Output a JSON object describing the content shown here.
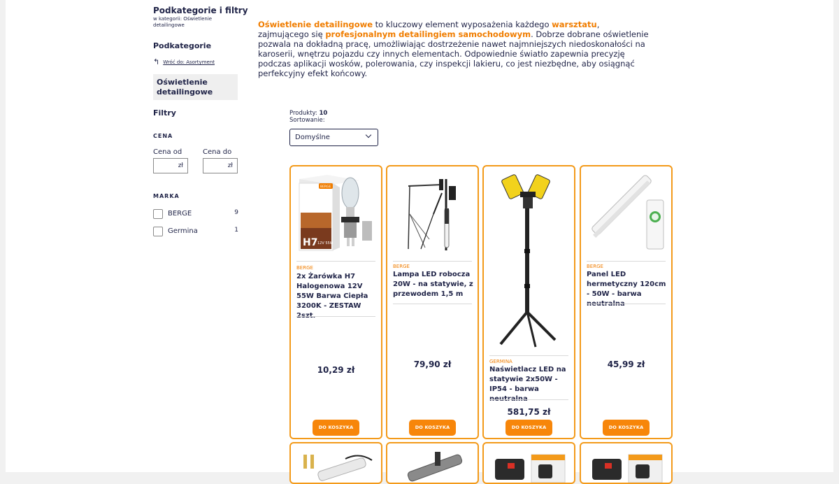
{
  "sidebar": {
    "title": "Podkategorie i filtry",
    "subtitle": "w kategorii: Oświetlenie detailingowe",
    "subcategories_heading": "Podkategorie",
    "back_arrow": "↰",
    "back_link": "Wróć do: Asortyment",
    "active_category": "Oświetlenie detailingowe",
    "filters_heading": "Filtry",
    "price": {
      "heading": "CENA",
      "from_label": "Cena od",
      "to_label": "Cena do",
      "currency": "zł"
    },
    "brand": {
      "heading": "MARKA",
      "items": [
        {
          "name": "BERGE",
          "count": "9"
        },
        {
          "name": "Germina",
          "count": "1"
        }
      ]
    }
  },
  "intro": {
    "p1": "Oświetlenie detailingowe",
    "p2": " to kluczowy element wyposażenia każdego ",
    "p3": "warsztatu",
    "p4": ", zajmującego się ",
    "p5": "profesjonalnym detailingiem samochodowym",
    "p6": ". Dobrze dobrane oświetlenie pozwala na dokładną pracę, umożliwiając dostrzeżenie nawet najmniejszych niedoskonałości na karoserii, wnętrzu pojazdu czy innych elementach. Odpowiednie światło zapewnia precyzję podczas aplikacji wosków, polerowania, czy inspekcji lakieru, co jest niezbędne, aby osiągnąć perfekcyjny efekt końcowy."
  },
  "listing": {
    "count_label": "Produkty:",
    "count_value": "10",
    "sort_label": "Sortowanie:",
    "sort_value": "Domyślne"
  },
  "products": [
    {
      "brand": "BERGE",
      "name": "2x Żarówka H7 Halogenowa 12V 55W Barwa Ciepła 3200K - ZESTAW 2szt.",
      "price": "10,29 zł",
      "button": "DO KOSZYKA",
      "box_brand": "BERGE",
      "box_text": "H7",
      "box_spec": "12V 55W"
    },
    {
      "brand": "BERGE",
      "name": "Lampa LED robocza 20W - na statywie, z przewodem 1,5 m",
      "price": "79,90 zł",
      "button": "DO KOSZYKA"
    },
    {
      "brand": "GERMINA",
      "name": "Naświetlacz LED na statywie 2x50W - IP54 - barwa neutralna",
      "price": "581,75 zł",
      "button": "DO KOSZYKA"
    },
    {
      "brand": "BERGE",
      "name": "Panel LED hermetyczny 120cm - 50W - barwa neutralna",
      "price": "45,99 zł",
      "button": "DO KOSZYKA"
    }
  ],
  "colors": {
    "accent": "#f07d00",
    "card_border": "#f39a1a",
    "button": "#f7860a",
    "text": "#1f2347"
  }
}
